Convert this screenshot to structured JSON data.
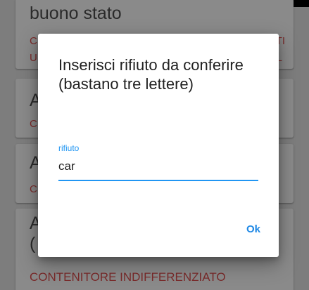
{
  "background": {
    "items": [
      {
        "title": "buono stato",
        "category_left": "C",
        "category_left2": "U",
        "category_right": "TI",
        "category_right2": "L"
      },
      {
        "title": "A",
        "category": "C"
      },
      {
        "title": "A",
        "category": "C"
      },
      {
        "title": "A",
        "title2": "(",
        "category": "CONTENITORE INDIFFERENZIATO"
      }
    ]
  },
  "dialog": {
    "title": "Inserisci rifiuto da conferire (bastano tre lettere)",
    "field_label": "rifiuto",
    "field_value": "car",
    "ok_label": "Ok"
  },
  "colors": {
    "accent": "#2196f3",
    "category_red": "#c62828",
    "scrim": "rgba(0,0,0,0.5)"
  }
}
